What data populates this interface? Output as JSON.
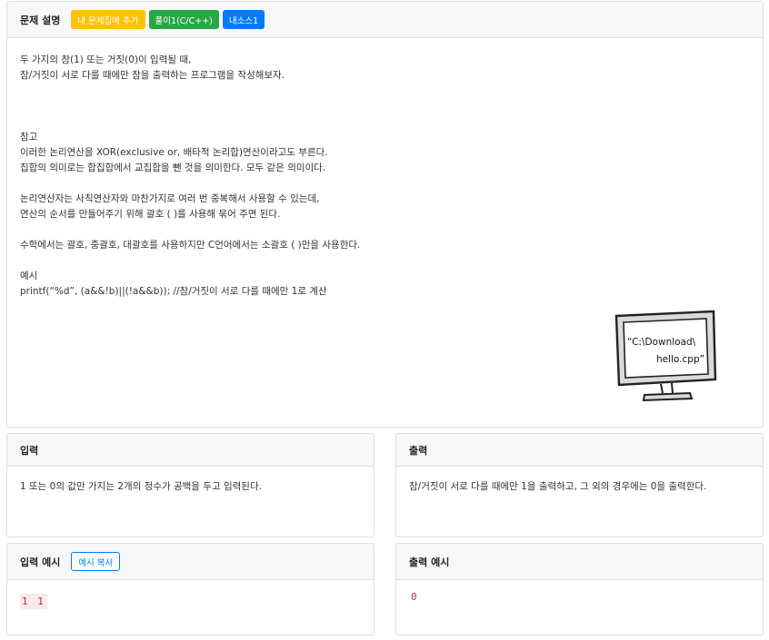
{
  "problem": {
    "title": "문제 설명",
    "buttons": {
      "add_label": "내 문제집에 추가",
      "solve_label": "풀이1(C/C++)",
      "source_label": "내소스1"
    },
    "lines": [
      "두 가지의 참(1) 또는 거짓(0)이 입력될 때,",
      "참/거짓이 서로 다를 때에만 참을 출력하는 프로그램을 작성해보자.",
      "",
      "",
      "",
      "참고",
      "이러한 논리연산을 XOR(exclusive or, 배타적 논리합)연산이라고도 부른다.",
      "집합의 의미로는 합집합에서 교집합을 뺀 것을 의미한다. 모두 같은 의미이다.",
      "",
      "논리연산자는 사칙연산자와 마찬가지로 여러 번 중복해서 사용할 수 있는데,",
      "연산의 순서를 만들어주기 위해 괄호 ( )를 사용해 묶어 주면 된다.",
      "",
      "수학에서는 괄호, 중괄호, 대괄호를 사용하지만 C언어에서는 소괄호 ( )만을 사용한다.",
      "",
      "예시",
      "printf(“%d”, (a&&!b)||(!a&&b)); //참/거짓이 서로 다를 때에만 1로 계산"
    ],
    "illustration": {
      "line1": "“C:\\Download\\",
      "line2": "hello.cpp”"
    }
  },
  "input": {
    "title": "입력",
    "text": "1 또는 0의 값만 가지는 2개의 정수가 공백을 두고 입력된다."
  },
  "output": {
    "title": "출력",
    "text": "참/거짓이 서로 다를 때에만 1을 출력하고, 그 외의 경우에는 0을 출력한다."
  },
  "sample_input": {
    "title": "입력 예시",
    "copy_label": "예시 복사",
    "value": "1 1"
  },
  "sample_output": {
    "title": "출력 예시",
    "value": "0"
  }
}
